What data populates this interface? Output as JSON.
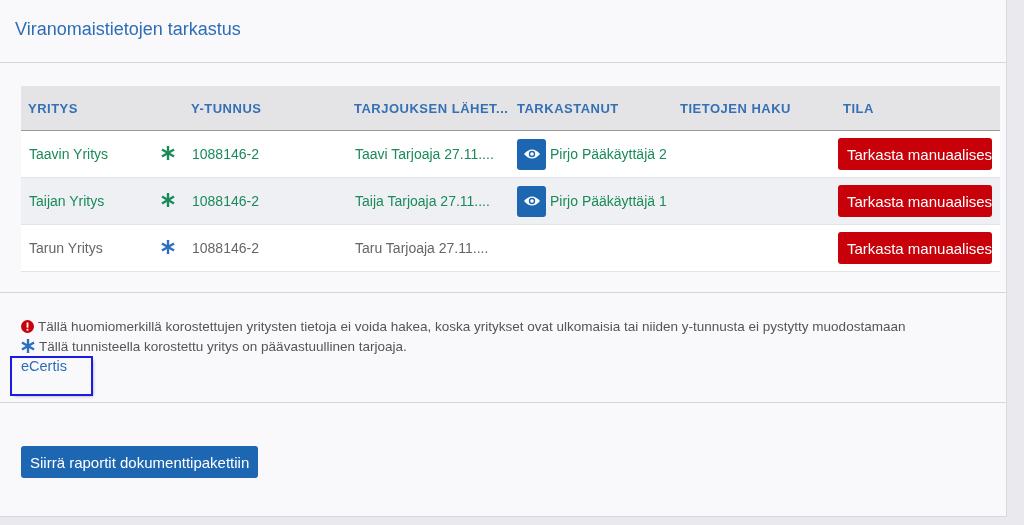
{
  "title": "Viranomaistietojen tarkastus",
  "table": {
    "columns": [
      "YRITYS",
      "Y-TUNNUS",
      "TARJOUKSEN LÄHET...",
      "TARKASTANUT",
      "TIETOJEN HAKU",
      "TILA"
    ],
    "rows": [
      {
        "kind": "checked",
        "company": "Taavin Yritys",
        "business_id": "1088146-2",
        "sender": "Taavi Tarjoaja 27.11....",
        "reviewer": "Pirjo Pääkäyttäjä 2",
        "status": "Tarkasta manuaalises"
      },
      {
        "kind": "checked",
        "company": "Taijan Yritys",
        "business_id": "1088146-2",
        "sender": "Taija Tarjoaja 27.11....",
        "reviewer": "Pirjo Pääkäyttäjä 1",
        "status": "Tarkasta manuaalises"
      },
      {
        "kind": "pending",
        "company": "Tarun Yritys",
        "business_id": "1088146-2",
        "sender": "Taru Tarjoaja 27.11....",
        "status": "Tarkasta manuaalises"
      }
    ]
  },
  "notes": [
    {
      "kind": "warning",
      "text": "Tällä huomiomerkillä korostettujen yritysten tietoja ei voida hakea, koska yritykset ovat ulkomaisia tai niiden y-tunnusta ei pystytty muodostamaan"
    },
    {
      "kind": "lead",
      "text": "Tällä tunnisteella korostettu yritys on päävastuullinen tarjoaja."
    }
  ],
  "link": {
    "label": "eCertis",
    "focused": true
  },
  "button": "Siirrä raportit dokumenttipakettiin"
}
